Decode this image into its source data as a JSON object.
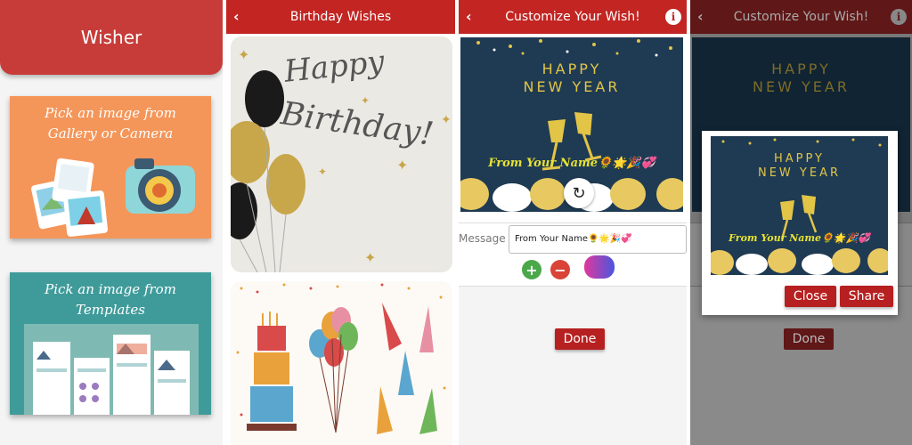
{
  "home": {
    "title": "Wisher",
    "option_gallery": "Pick an image from Gallery or Camera",
    "option_templates": "Pick an image from Templates"
  },
  "wishes": {
    "title": "Birthday Wishes",
    "card1_line1": "Happy",
    "card1_line2": "Birthday!"
  },
  "customize": {
    "title": "Customize Your Wish!",
    "card_line1": "HAPPY",
    "card_line2": "NEW YEAR",
    "card_from": "From Your Name🌻🌟🎉💞",
    "message_label": "Message",
    "message_value": "From Your Name🌻🌟🎉💞",
    "done_label": "Done"
  },
  "preview_dialog": {
    "close_label": "Close",
    "share_label": "Share"
  },
  "colors": {
    "brand_red": "#c22522",
    "card_navy": "#1f3b53",
    "gold": "#e2c447"
  }
}
